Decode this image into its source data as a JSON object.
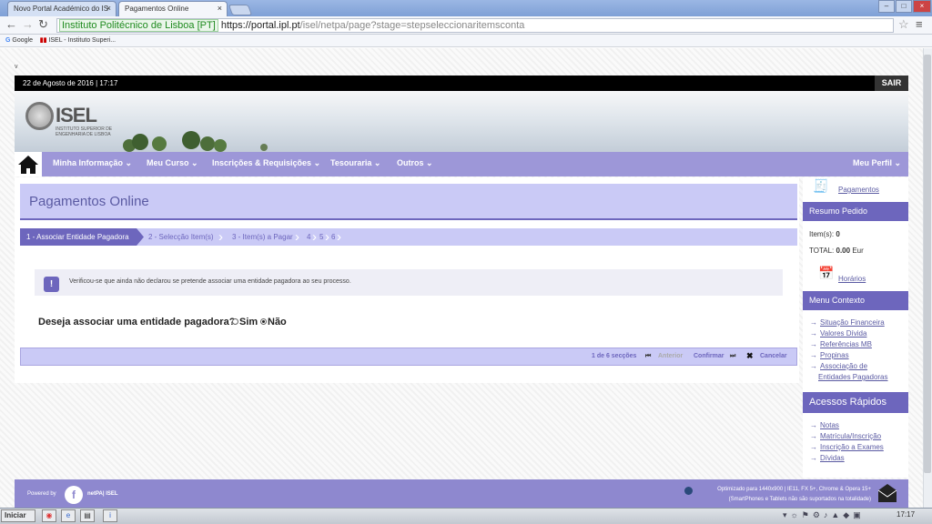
{
  "browser": {
    "tabs": [
      {
        "label": "Novo Portal Académico do IS"
      },
      {
        "label": "Pagamentos Online"
      }
    ],
    "url": {
      "site": "Instituto Politécnico de Lisboa [PT]",
      "host": "https://portal.ipl.pt",
      "path": "/isel/netpa/page?stage=stepseleccionaritemsconta"
    },
    "bookmarks": [
      "Google",
      "ISEL - Instituto Superi..."
    ]
  },
  "page": {
    "corner_mark": "v",
    "datetime": "22 de Agosto de 2016 | 17:17",
    "logout": "SAIR",
    "logo": {
      "name": "ISEL",
      "subtitle": "INSTITUTO SUPERIOR DE ENGENHARIA DE LISBOA"
    },
    "nav": {
      "items": [
        "Minha Informação",
        "Meu Curso",
        "Inscrições & Requisições",
        "Tesouraria",
        "Outros"
      ],
      "profile": "Meu Perfil"
    },
    "main": {
      "title": "Pagamentos Online",
      "steps": [
        "1 - Associar Entidade Pagadora",
        "2 - Selecção Item(s)",
        "3 - Item(s) a Pagar",
        "4",
        "5",
        "6"
      ],
      "info": "Verificou-se que ainda não declarou se pretende associar uma entidade pagadora ao seu processo.",
      "question": "Deseja associar uma entidade pagadora?",
      "required_mark": "*",
      "options": [
        {
          "label": "Sim",
          "selected": false
        },
        {
          "label": "Não",
          "selected": true
        }
      ],
      "actions": {
        "sections": "1 de 6 secções",
        "previous": "Anterior",
        "confirm": "Confirmar",
        "cancel": "Cancelar"
      }
    },
    "sidebar": {
      "payments_link": "Pagamentos",
      "summary_header": "Resumo Pedido",
      "items_label": "Item(s):",
      "items_value": "0",
      "total_label": "TOTAL:",
      "total_value": "0.00",
      "total_unit": "Eur",
      "schedule_link": "Horários",
      "context_header": "Menu Contexto",
      "context_links": [
        "Situação Financeira",
        "Valores Dívida",
        "Referências MB",
        "Propinas",
        "Associação de",
        "Entidades Pagadoras"
      ],
      "quick_header": "Acessos Rápidos",
      "quick_links": [
        "Notas",
        "Matrícula/Inscrição",
        "Inscrição a Exames",
        "Dívidas"
      ]
    },
    "footer": {
      "powered": "Powered by",
      "brand": "netPA| ISEL",
      "optimized_line1": "Optimizado para 1440x900 | IE11, FX 5+, Chrome & Opera 15+",
      "optimized_line2": "(SmartPhones e Tablets não são suportados na totalidade)"
    }
  },
  "taskbar": {
    "start": "Iniciar",
    "clock": "17:17"
  },
  "colors": {
    "accent": "#6d66bd",
    "light_accent": "#cacaf6",
    "nav": "#9d97d8"
  }
}
